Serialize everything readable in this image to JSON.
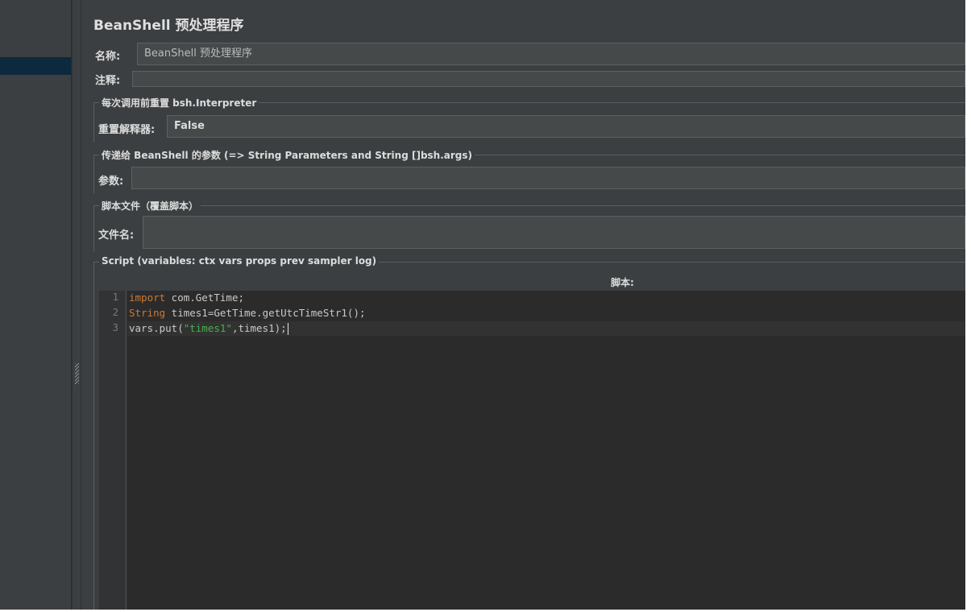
{
  "panel": {
    "title": "BeanShell 预处理程序",
    "name_label": "名称:",
    "name_value": "BeanShell 预处理程序",
    "comment_label": "注释:",
    "comment_value": ""
  },
  "reset_group": {
    "title": "每次调用前重置 bsh.Interpreter",
    "label": "重置解释器:",
    "value": "False"
  },
  "params_group": {
    "title": "传递给 BeanShell 的参数 (=> String Parameters and String []bsh.args)",
    "label": "参数:",
    "value": ""
  },
  "file_group": {
    "title": "脚本文件（覆盖脚本）",
    "label": "文件名:",
    "value": ""
  },
  "script_group": {
    "title": "Script (variables: ctx vars props prev sampler log)",
    "editor_label": "脚本:",
    "lines": [
      {
        "number": "1",
        "keyword": "import",
        "text": " com.GetTime;"
      },
      {
        "number": "2",
        "keyword": "String",
        "text": " times1=GetTime.getUtcTimeStr1();"
      },
      {
        "number": "3",
        "prefix": "vars.put(",
        "string": "\"times1\"",
        "suffix": ",times1);"
      }
    ]
  },
  "colors": {
    "background": "#3c3f41",
    "editor_bg": "#2b2b2b",
    "keyword": "#cc7832",
    "string": "#4caf50",
    "tree_selection": "#0d293e"
  }
}
